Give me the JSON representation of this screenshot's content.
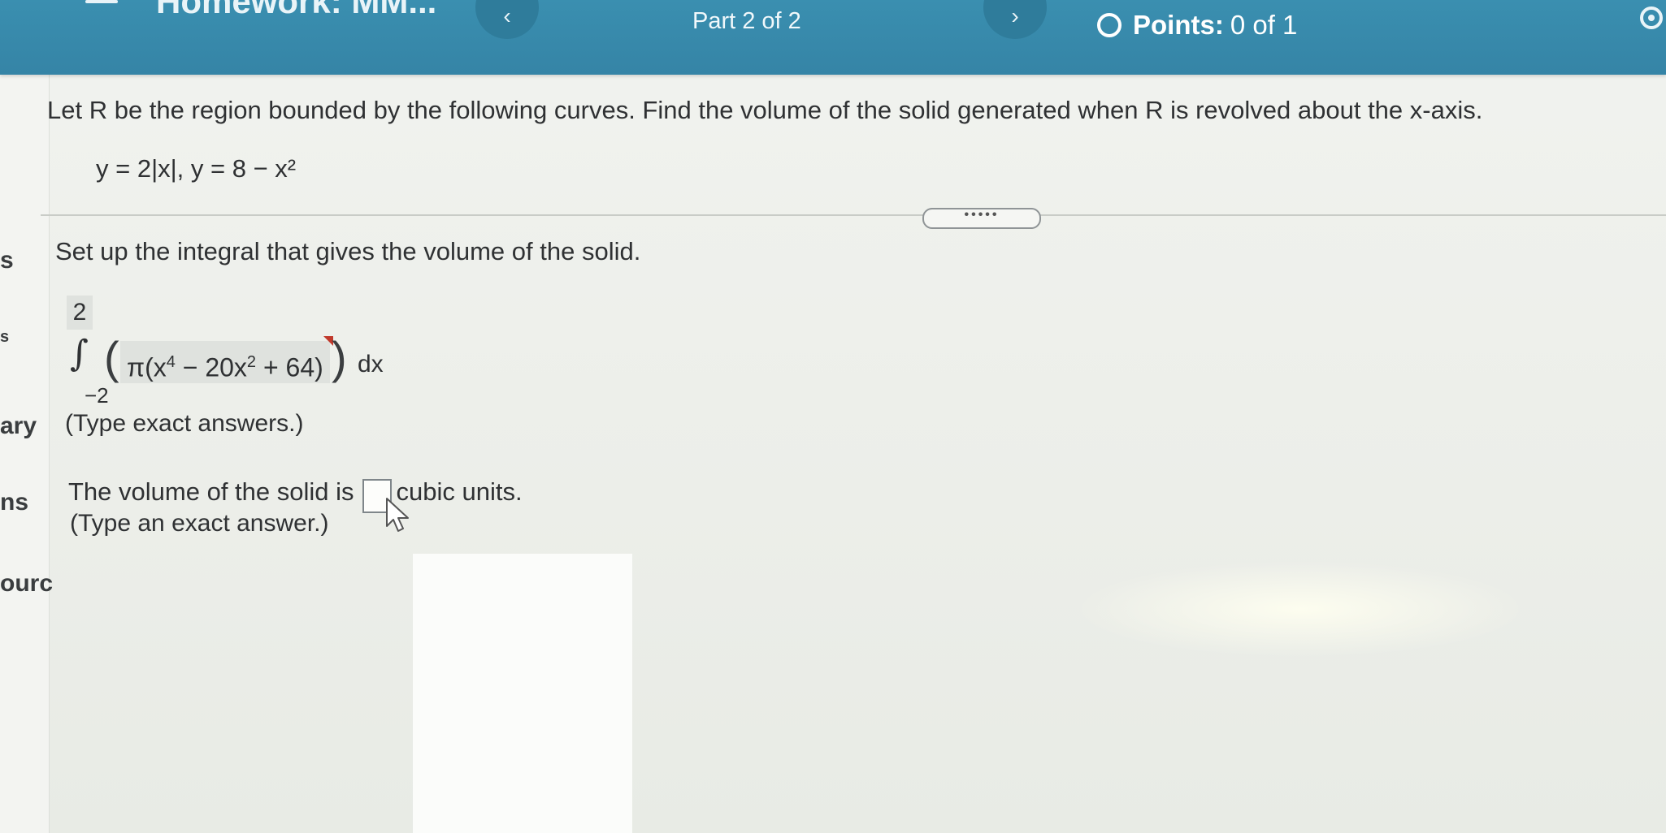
{
  "header": {
    "title": "Homework: MM...",
    "part": "Part 2 of 2",
    "points_label": "Points:",
    "points_value": "0 of 1",
    "prev": "‹",
    "next": "›"
  },
  "sidebar": {
    "fragments": [
      "s",
      "s",
      "ary",
      "ns",
      "ourc"
    ]
  },
  "question": {
    "prompt": "Let R be the region bounded by the following curves. Find the volume of the solid generated when R is revolved about the x-axis.",
    "curves": "y = 2|x|, y = 8 − x²"
  },
  "expand_label": "•••••",
  "setup": {
    "instruction": "Set up the integral that gives the volume of the solid.",
    "upper_limit": "2",
    "lower_limit": "−2",
    "integrand_pi": "π",
    "integrand_open": "(x",
    "exp4": "4",
    "mid": " − 20x",
    "exp2": "2",
    "tail": " + 64)",
    "differential": "dx",
    "hint": "(Type exact answers.)"
  },
  "answer": {
    "before": "The volume of the solid is",
    "after": "cubic units.",
    "value": "",
    "hint": "(Type an exact answer.)"
  }
}
